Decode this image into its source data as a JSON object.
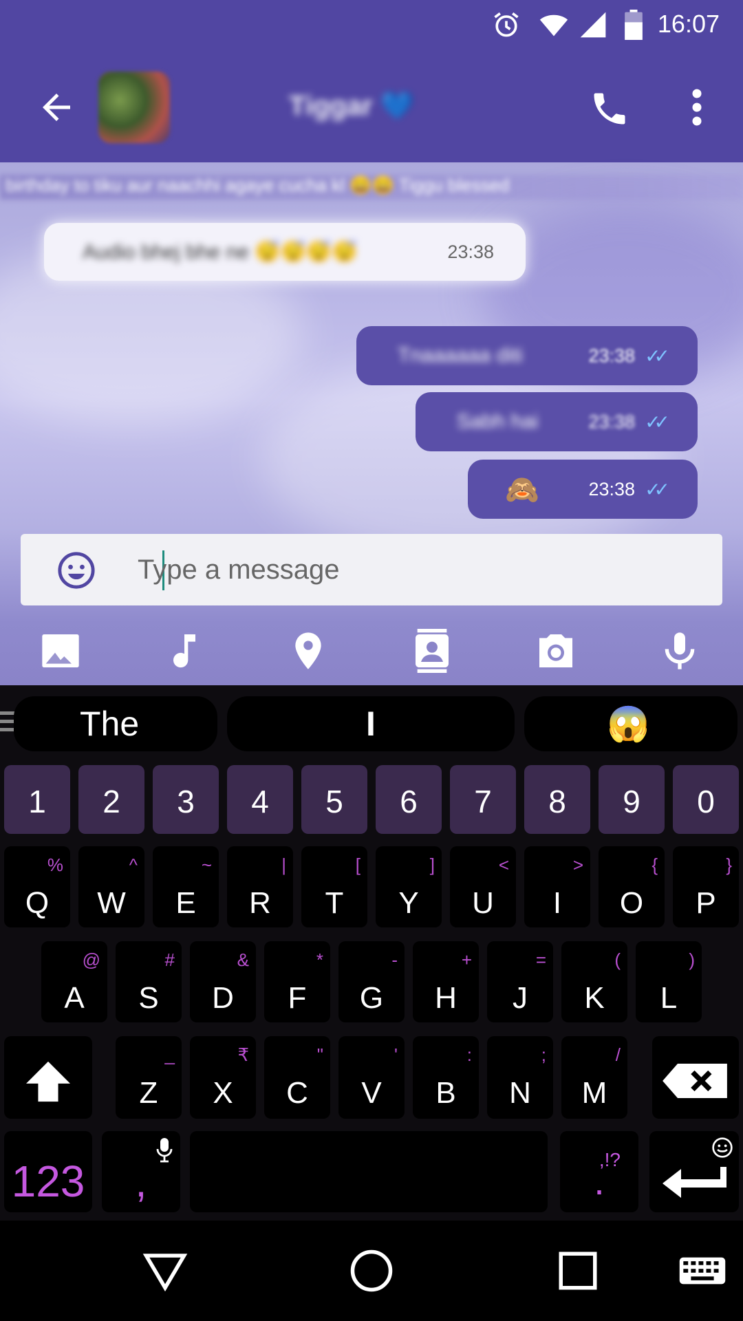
{
  "status_bar": {
    "time": "16:07",
    "icons": [
      "alarm-icon",
      "wifi-icon",
      "signal-icon",
      "battery-icon"
    ]
  },
  "app_bar": {
    "contact_name": "Tiggar 💙",
    "icons": [
      "back-arrow-icon",
      "phone-icon",
      "more-vert-icon"
    ]
  },
  "chat": {
    "banner": "birthday to tiku aur naachhi agaye cucha kl 😀😀 Tiggu blessed",
    "messages": [
      {
        "direction": "incoming",
        "text": "Audio bhej bhe ne 😴😴😴😴",
        "time": "23:38"
      },
      {
        "direction": "outgoing",
        "text": "Tnaaaaaa diti",
        "time": "23:38",
        "ticks": "✓✓"
      },
      {
        "direction": "outgoing",
        "text": "Sabh hai",
        "time": "23:38",
        "ticks": "✓✓"
      },
      {
        "direction": "outgoing",
        "text": "🙈",
        "time": "23:38",
        "ticks": "✓✓"
      }
    ]
  },
  "composer": {
    "placeholder": "Type a message",
    "value": ""
  },
  "attachments": [
    "gallery-icon",
    "music-icon",
    "location-icon",
    "contact-icon",
    "camera-icon",
    "mic-icon"
  ],
  "keyboard": {
    "suggestions": [
      "The",
      "I",
      "😱"
    ],
    "number_row": [
      "1",
      "2",
      "3",
      "4",
      "5",
      "6",
      "7",
      "8",
      "9",
      "0"
    ],
    "row1": [
      {
        "k": "Q",
        "h": "%"
      },
      {
        "k": "W",
        "h": "^"
      },
      {
        "k": "E",
        "h": "~"
      },
      {
        "k": "R",
        "h": "|"
      },
      {
        "k": "T",
        "h": "["
      },
      {
        "k": "Y",
        "h": "]"
      },
      {
        "k": "U",
        "h": "<"
      },
      {
        "k": "I",
        "h": ">"
      },
      {
        "k": "O",
        "h": "{"
      },
      {
        "k": "P",
        "h": "}"
      }
    ],
    "row2": [
      {
        "k": "A",
        "h": "@"
      },
      {
        "k": "S",
        "h": "#"
      },
      {
        "k": "D",
        "h": "&"
      },
      {
        "k": "F",
        "h": "*"
      },
      {
        "k": "G",
        "h": "-"
      },
      {
        "k": "H",
        "h": "+"
      },
      {
        "k": "J",
        "h": "="
      },
      {
        "k": "K",
        "h": "("
      },
      {
        "k": "L",
        "h": ")"
      }
    ],
    "row3": [
      {
        "k": "Z",
        "h": "_"
      },
      {
        "k": "X",
        "h": "₹"
      },
      {
        "k": "C",
        "h": "\""
      },
      {
        "k": "V",
        "h": "'"
      },
      {
        "k": "B",
        "h": ":"
      },
      {
        "k": "N",
        "h": ";"
      },
      {
        "k": "M",
        "h": "/"
      }
    ],
    "symbols_label": "123",
    "comma_label": ",",
    "period_label": ".",
    "period_hint": ",!?"
  },
  "nav_bar": {
    "icons": [
      "back-triangle-icon",
      "home-circle-icon",
      "recents-square-icon",
      "keyboard-switch-icon"
    ]
  },
  "colors": {
    "primary": "#5146a2",
    "outgoing_bubble": "#5a4fa8",
    "keyboard_bg": "#0e0c10",
    "key_num": "#3b2a4e",
    "accent_hint": "#b84fcf"
  }
}
